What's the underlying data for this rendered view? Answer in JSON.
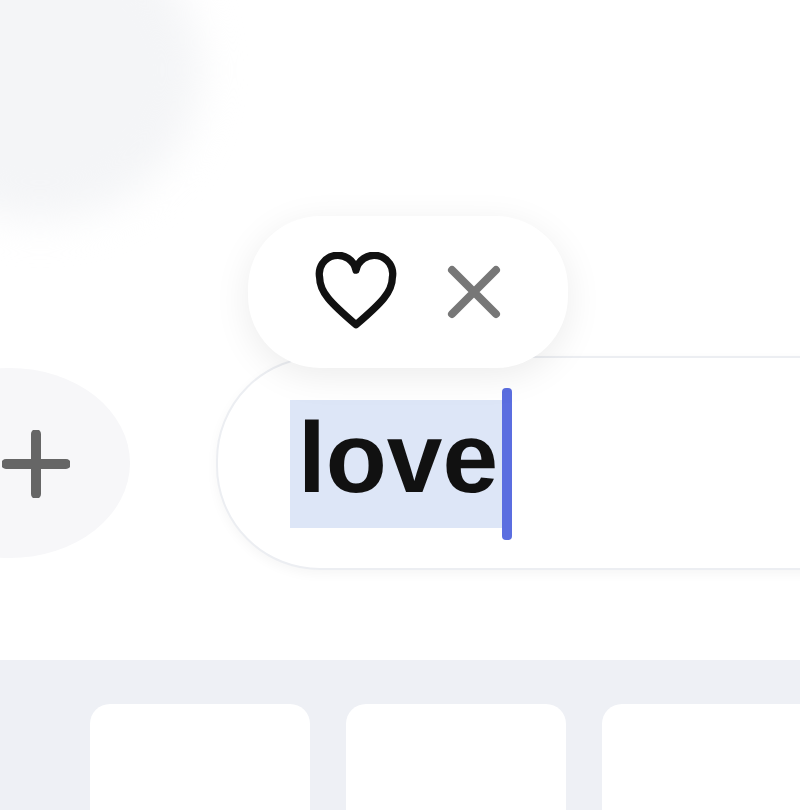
{
  "message_field": {
    "value": "love",
    "selected": true
  }
}
